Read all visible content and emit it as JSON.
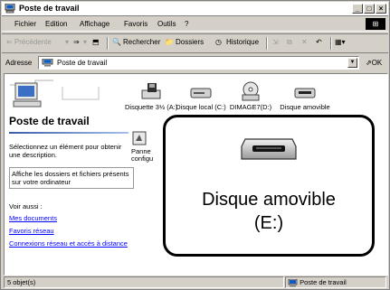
{
  "window": {
    "title": "Poste de travail",
    "controls": [
      "_",
      "□",
      "×"
    ]
  },
  "menu": {
    "items": [
      "Fichier",
      "Edition",
      "Affichage",
      "Favoris",
      "Outils",
      "?"
    ]
  },
  "toolbar": {
    "back": "⇐ Précédente",
    "forward": "⇒",
    "search": "Rechercher",
    "folders": "Dossiers",
    "history": "Historique"
  },
  "address": {
    "label": "Adresse",
    "value": "Poste de travail",
    "go": "OK"
  },
  "left_pane": {
    "title": "Poste de travail",
    "hint": "Sélectionnez un élément pour obtenir une description.",
    "info": "Affiche les dossiers et fichiers présents sur votre ordinateur",
    "see_also": "Voir aussi :",
    "links": [
      "Mes documents",
      "Favoris réseau",
      "Connexions réseau et accès à distance"
    ]
  },
  "drives": [
    {
      "label": "Disquette 3½ (A:)",
      "icon": "floppy-drive-icon"
    },
    {
      "label": "Disque local (C:)",
      "icon": "hard-disk-icon"
    },
    {
      "label": "DIMAGE7(D:)",
      "icon": "cd-drive-icon"
    },
    {
      "label": "Disque amovible",
      "icon": "removable-disk-icon"
    }
  ],
  "extra_item": {
    "label_line1": "Panne",
    "label_line2": "configu"
  },
  "callout": {
    "label_line1": "Disque amovible",
    "label_line2": "(E:)"
  },
  "status": {
    "count": "5 objet(s)",
    "location": "Poste de travail"
  }
}
